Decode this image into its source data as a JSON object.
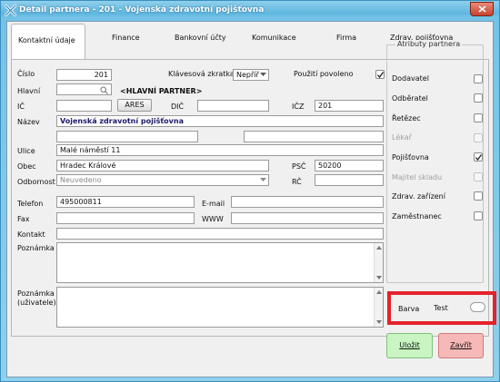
{
  "window": {
    "title": "Detail partnera - 201 - Vojenská zdravotní pojišťovna"
  },
  "tabs": [
    {
      "label": "Kontaktní údaje"
    },
    {
      "label": "Finance"
    },
    {
      "label": "Bankovní účty"
    },
    {
      "label": "Komunikace"
    },
    {
      "label": "Firma"
    },
    {
      "label": "Zdrav. pojišťovna"
    }
  ],
  "form": {
    "cislo_label": "Číslo",
    "cislo_value": "201",
    "shortcut_label": "Klávesová zkratka",
    "shortcut_value": "Nepříř",
    "enabled_label": "Použití povoleno",
    "enabled_checked": true,
    "hlavni_label": "Hlavní",
    "hlavni_value": "",
    "hlavni_partner_text": "<HLAVNÍ PARTNER>",
    "ic_label": "IČ",
    "ic_value": "",
    "ares_label": "ARES",
    "dic_label": "DIČ",
    "dic_value": "",
    "icz_label": "IČZ",
    "icz_value": "201",
    "nazev_label": "Název",
    "nazev_value": "Vojenská zdravotní pojišťovna",
    "nazev2_value": "",
    "nazev3_value": "",
    "ulice_label": "Ulice",
    "ulice_value": "Malé náměstí 11",
    "obec_label": "Obec",
    "obec_value": "Hradec Králové",
    "psc_label": "PSČ",
    "psc_value": "50200",
    "odbornost_label": "Odbornost",
    "odbornost_value": "Neuvedeno",
    "rc_label": "RČ",
    "rc_value": "",
    "telefon_label": "Telefon",
    "telefon_value": "495000811",
    "email_label": "E-mail",
    "email_value": "",
    "fax_label": "Fax",
    "fax_value": "",
    "www_label": "WWW",
    "www_value": "",
    "kontakt_label": "Kontakt",
    "kontakt_value": "",
    "poznamka_label": "Poznámka",
    "poznamka_user_label_1": "Poznámka",
    "poznamka_user_label_2": "(uživatele)"
  },
  "attributes": {
    "title": "Atributy partnera",
    "items": [
      {
        "label": "Dodavatel",
        "checked": false,
        "disabled": false
      },
      {
        "label": "Odběratel",
        "checked": false,
        "disabled": false
      },
      {
        "label": "Řetězec",
        "checked": false,
        "disabled": false
      },
      {
        "label": "Lékař",
        "checked": false,
        "disabled": true
      },
      {
        "label": "Pojišťovna",
        "checked": true,
        "disabled": false
      },
      {
        "label": "Majitel skladu",
        "checked": false,
        "disabled": true
      },
      {
        "label": "Zdrav. zařízení",
        "checked": false,
        "disabled": false
      },
      {
        "label": "Zaměstnanec",
        "checked": false,
        "disabled": false
      }
    ]
  },
  "color": {
    "label": "Barva",
    "value": "Test",
    "highlight_color": "#e4222b"
  },
  "actions": {
    "save_label": "Uložit",
    "close_label": "Zavřít",
    "save_color": "#c9f5c2",
    "close_color": "#f7b9b7"
  }
}
